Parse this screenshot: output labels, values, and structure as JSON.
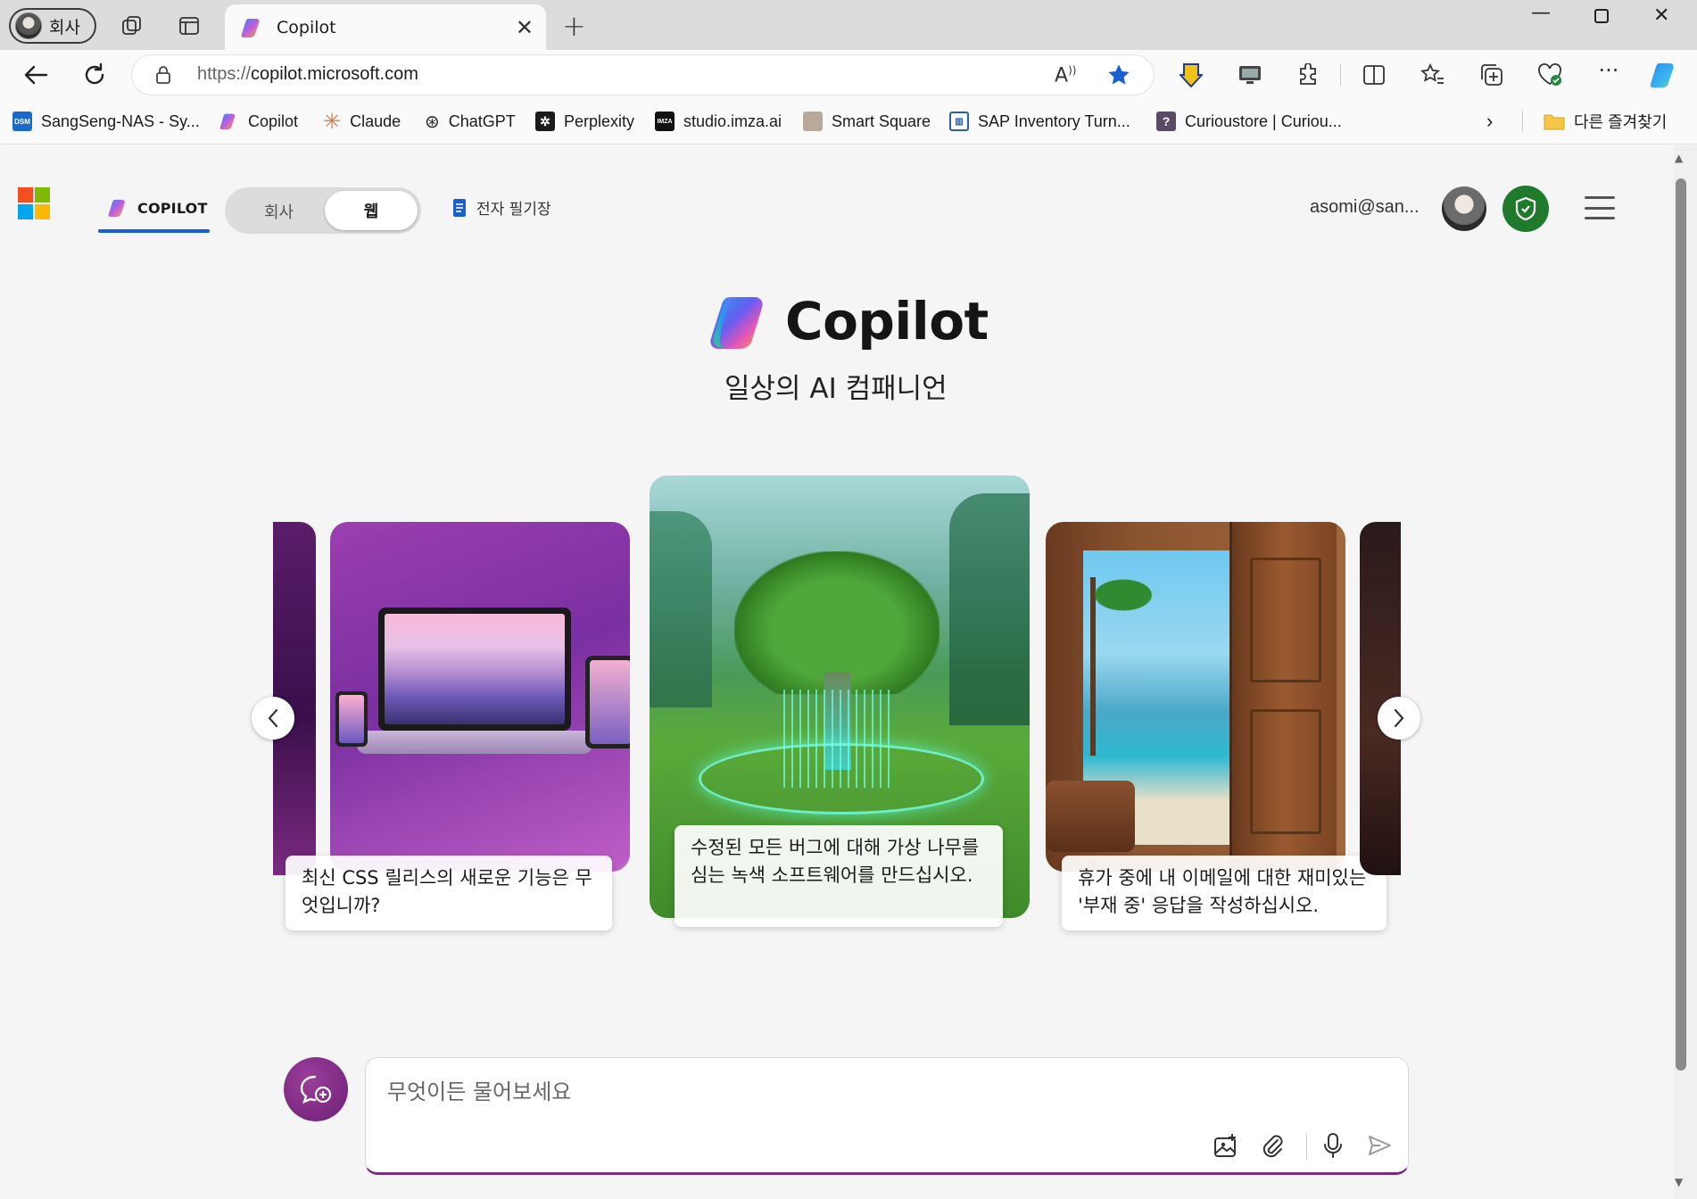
{
  "browser": {
    "profile_label": "회사",
    "tab_title": "Copilot",
    "address_scheme": "https://",
    "address_host": "copilot.microsoft.com",
    "bookmarks": [
      {
        "label": "SangSeng-NAS - Sy...",
        "icon": "dsm-icon"
      },
      {
        "label": "Copilot",
        "icon": "copilot-icon"
      },
      {
        "label": "Claude",
        "icon": "claude-icon"
      },
      {
        "label": "ChatGPT",
        "icon": "chatgpt-icon"
      },
      {
        "label": "Perplexity",
        "icon": "perplexity-icon"
      },
      {
        "label": "studio.imza.ai",
        "icon": "imza-icon"
      },
      {
        "label": "Smart Square",
        "icon": "smart-square-icon"
      },
      {
        "label": "SAP Inventory Turn...",
        "icon": "sap-icon"
      },
      {
        "label": "Curioustore | Curiou...",
        "icon": "curioustore-icon"
      }
    ],
    "other_favorites": "다른 즐겨찾기"
  },
  "header": {
    "copilot_tab": "COPILOT",
    "toggle_off": "회사",
    "toggle_on": "웹",
    "notebook": "전자 필기장",
    "user_email": "asomi@san..."
  },
  "hero": {
    "title": "Copilot",
    "subtitle": "일상의 AI 컴패니언"
  },
  "carousel": {
    "cards": [
      {
        "caption": "최신 CSS 릴리스의 새로운 기능은 무엇입니까?"
      },
      {
        "caption": "수정된 모든 버그에 대해 가상 나무를 심는 녹색 소프트웨어를 만드십시오."
      },
      {
        "caption": "휴가 중에 내 이메일에 대한 재미있는 '부재 중' 응답을 작성하십시오."
      }
    ]
  },
  "composer": {
    "placeholder": "무엇이든 물어보세요"
  },
  "colors": {
    "accent": "#1a5fd1",
    "chat_button": "#7a2c7f",
    "shield": "#1f7a2b"
  }
}
